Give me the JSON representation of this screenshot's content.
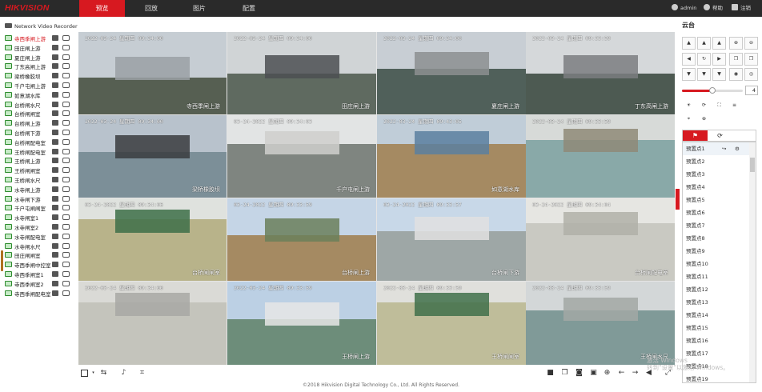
{
  "brand": {
    "logo": "HIKVISION"
  },
  "nav": {
    "items": [
      {
        "label": "预览",
        "active": true
      },
      {
        "label": "回放",
        "active": false
      },
      {
        "label": "图片",
        "active": false
      },
      {
        "label": "配置",
        "active": false
      }
    ]
  },
  "user": {
    "name": "admin",
    "help": "帮助",
    "logout": "注销"
  },
  "sidebar": {
    "title": "Network Video Recorder",
    "cameras": [
      "寺西季闸上游",
      "田庄闸上游",
      "夏庄闸上游",
      "丁东高闸上游",
      "梁桥橡胶坝",
      "千户屯闸上游",
      "如意湖水库",
      "台桥闸水尺",
      "台桥闸闸室",
      "台桥闸上游",
      "台桥闸下游",
      "台桥闸配电室",
      "王桥闸配电室",
      "王桥闸上游",
      "王桥闸闸室",
      "王桥闸水尺",
      "水寺闸上游",
      "水寺闸下游",
      "千户屯闸闸室",
      "水寺闸室1",
      "水寺闸室2",
      "水寺闸配电室",
      "水寺闸水尺",
      "田庄闸闸室",
      "寺西季闸中控室",
      "寺西季闸室1",
      "寺西季闸室2",
      "寺西季闸配电室"
    ],
    "selected_index": 0
  },
  "tiles": [
    {
      "ts": "2022-03-24 星期四 09:34:00",
      "name": "寺西季闸上游"
    },
    {
      "ts": "2022-03-24 星期四 09:34:00",
      "name": "田庄闸上游"
    },
    {
      "ts": "2022-03-24 星期四 09:34:00",
      "name": "夏庄闸上游"
    },
    {
      "ts": "2022-03-24 星期四 09:33:59",
      "name": "丁东高闸上游"
    },
    {
      "ts": "2022-03-24 星期四 09:34:00",
      "name": "梁桥橡胶坝"
    },
    {
      "ts": "03-24-2022 星期四 09:34:03",
      "name": "千户屯闸上游"
    },
    {
      "ts": "2022-03-24 星期四 09:43:05",
      "name": "如意湖水库"
    },
    {
      "ts": "2022-03-24 星期四 09:33:59",
      "name": ""
    },
    {
      "ts": "03-24-2022 星期四 09:34:06",
      "name": "台桥闸闸室"
    },
    {
      "ts": "03-24-2022 星期四 09:33:59",
      "name": "台桥闸上游"
    },
    {
      "ts": "03-24-2022 星期四 09:33:57",
      "name": "台桥闸下游"
    },
    {
      "ts": "03-24-2022 星期四 09:34:04",
      "name": "台桥闸配电室"
    },
    {
      "ts": "2022-03-24 星期四 09:34:00",
      "name": ""
    },
    {
      "ts": "2022-03-24 星期四 09:33:59",
      "name": "王桥闸上游"
    },
    {
      "ts": "2022-03-24 星期四 09:33:59",
      "name": "王桥闸闸室"
    },
    {
      "ts": "2022-03-24 星期四 09:33:59",
      "name": "王桥闸水尺"
    }
  ],
  "ptz": {
    "title": "云台",
    "speed": "4",
    "speed_level": 0.5,
    "presets": [
      "预置点1",
      "预置点2",
      "预置点3",
      "预置点4",
      "预置点5",
      "预置点6",
      "预置点7",
      "预置点8",
      "预置点9",
      "预置点10",
      "预置点11",
      "预置点12",
      "预置点13",
      "预置点14",
      "预置点15",
      "预置点16",
      "预置点17",
      "预置点18",
      "预置点19"
    ]
  },
  "watermark": {
    "line1": "激活 Windows",
    "line2": "转到\"设置\"以激活 Windows。"
  },
  "footer": {
    "copyright": "©2018 Hikvision Digital Technology Co., Ltd. All Rights Reserved."
  }
}
